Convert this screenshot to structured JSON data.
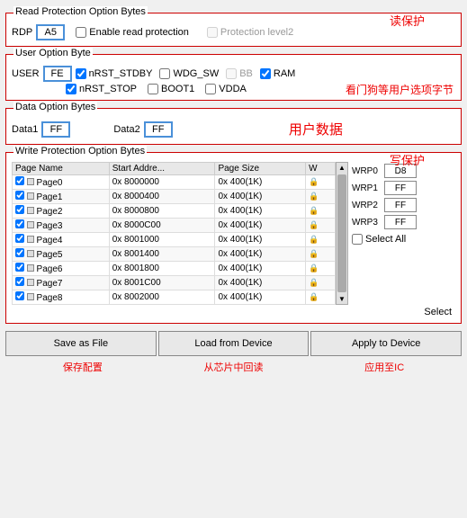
{
  "read_protection": {
    "label": "Read Protection Option Bytes",
    "annotation": "读保护",
    "rdp_label": "RDP",
    "rdp_value": "A5",
    "enable_read_protection": "Enable read protection",
    "enable_read_protection_checked": false,
    "protection_level2": "Protection level2",
    "protection_level2_checked": false
  },
  "user_option": {
    "label": "User Option Byte",
    "annotation": "看门狗等用户选项字节",
    "user_label": "USER",
    "user_value": "FE",
    "options": [
      {
        "label": "nRST_STDBY",
        "checked": true
      },
      {
        "label": "WDG_SW",
        "checked": false
      },
      {
        "label": "BB",
        "checked": false,
        "disabled": true
      },
      {
        "label": "RAM",
        "checked": true,
        "disabled": false
      }
    ],
    "options2": [
      {
        "label": "nRST_STOP",
        "checked": true
      },
      {
        "label": "BOOT1",
        "checked": false
      },
      {
        "label": "VDDA",
        "checked": false
      }
    ]
  },
  "data_option": {
    "label": "Data Option Bytes",
    "annotation": "用户数据",
    "data1_label": "Data1",
    "data1_value": "FF",
    "data2_label": "Data2",
    "data2_value": "FF"
  },
  "write_protection": {
    "label": "Write Protection Option Bytes",
    "annotation": "写保护",
    "table_headers": [
      "Page Name",
      "Start Addre...",
      "Page Size",
      "W"
    ],
    "pages": [
      {
        "checked": true,
        "name": "Page0",
        "start": "0x 8000000",
        "size": "0x 400(1K)",
        "locked": true
      },
      {
        "checked": true,
        "name": "Page1",
        "start": "0x 8000400",
        "size": "0x 400(1K)",
        "locked": true
      },
      {
        "checked": true,
        "name": "Page2",
        "start": "0x 8000800",
        "size": "0x 400(1K)",
        "locked": true
      },
      {
        "checked": true,
        "name": "Page3",
        "start": "0x 8000C00",
        "size": "0x 400(1K)",
        "locked": true
      },
      {
        "checked": true,
        "name": "Page4",
        "start": "0x 8001000",
        "size": "0x 400(1K)",
        "locked": true
      },
      {
        "checked": true,
        "name": "Page5",
        "start": "0x 8001400",
        "size": "0x 400(1K)",
        "locked": true
      },
      {
        "checked": true,
        "name": "Page6",
        "start": "0x 8001800",
        "size": "0x 400(1K)",
        "locked": true
      },
      {
        "checked": true,
        "name": "Page7",
        "start": "0x 8001C00",
        "size": "0x 400(1K)",
        "locked": true
      },
      {
        "checked": true,
        "name": "Page8",
        "start": "0x 8002000",
        "size": "0x 400(1K)",
        "locked": true
      }
    ],
    "right_labels": [
      "WRP0",
      "WRP1",
      "WRP2",
      "WRP3"
    ],
    "right_values": [
      "D8",
      "FF",
      "FF",
      "FF"
    ],
    "select_all": "Select All",
    "select_all_checked": false
  },
  "buttons": {
    "save_as_file": "Save as File",
    "load_from_device": "Load from Device",
    "apply_to_device": "Apply to Device"
  },
  "bottom_annotations": {
    "save": "保存配置",
    "load": "从芯片中回读",
    "apply": "应用至IC"
  }
}
